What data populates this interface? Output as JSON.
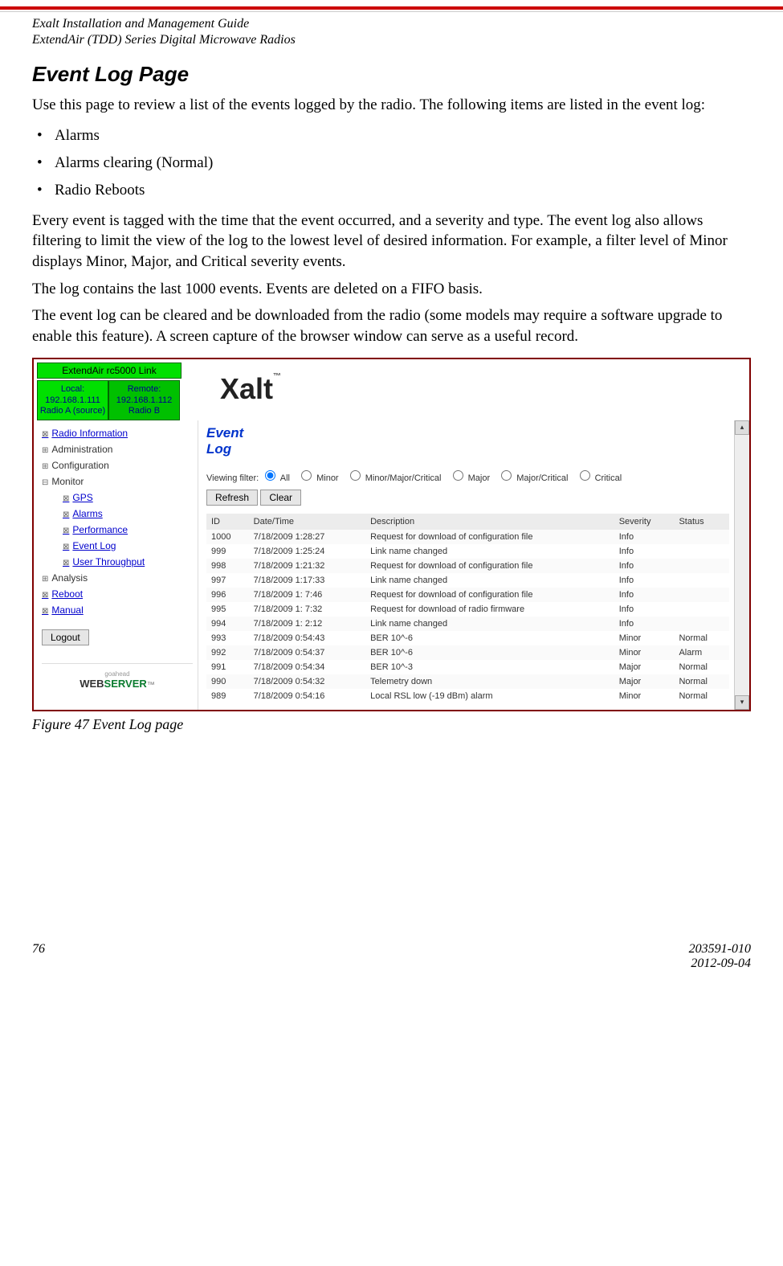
{
  "header": {
    "line1": "Exalt Installation and Management Guide",
    "line2": "ExtendAir (TDD) Series Digital Microwave Radios"
  },
  "title": "Event Log Page",
  "intro": "Use this page to review a list of the events logged by the radio. The following items are listed in the event log:",
  "bullets": [
    "Alarms",
    "Alarms clearing (Normal)",
    "Radio Reboots"
  ],
  "para1": "Every event is tagged with the time that the event occurred, and a severity and type. The event log also allows filtering to limit the view of the log to the lowest level of desired information. For example, a filter level of Minor displays Minor, Major, and Critical severity events.",
  "para2": "The log contains the last 1000 events. Events are deleted on a FIFO basis.",
  "para3": "The event log can be cleared and be downloaded from the radio (some models may require a software upgrade to enable this feature). A screen capture of the browser window can serve as a useful record.",
  "screenshot": {
    "link_name": "ExtendAir rc5000 Link",
    "local": {
      "l1": "Local:",
      "l2": "192.168.1.111",
      "l3": "Radio A (source)"
    },
    "remote": {
      "l1": "Remote:",
      "l2": "192.168.1.112",
      "l3": "Radio B"
    },
    "brand": "Xalt",
    "nav": {
      "radio_info": "Radio Information",
      "admin": "Administration",
      "config": "Configuration",
      "monitor": "Monitor",
      "gps": "GPS",
      "alarms": "Alarms",
      "perf": "Performance",
      "eventlog": "Event Log",
      "userthru": "User Throughput",
      "analysis": "Analysis",
      "reboot": "Reboot",
      "manual": "Manual",
      "logout": "Logout"
    },
    "webserver": {
      "go": "goahead",
      "web": "WEB",
      "server": "SERVER"
    },
    "main_title_l1": "Event",
    "main_title_l2": "Log",
    "filter_label": "Viewing filter:",
    "filters": [
      "All",
      "Minor",
      "Minor/Major/Critical",
      "Major",
      "Major/Critical",
      "Critical"
    ],
    "refresh": "Refresh",
    "clear": "Clear",
    "cols": {
      "id": "ID",
      "dt": "Date/Time",
      "desc": "Description",
      "sev": "Severity",
      "status": "Status"
    },
    "rows": [
      {
        "id": "1000",
        "dt": "7/18/2009 1:28:27",
        "desc": "Request for download of configuration file",
        "sev": "Info",
        "status": ""
      },
      {
        "id": "999",
        "dt": "7/18/2009 1:25:24",
        "desc": "Link name changed",
        "sev": "Info",
        "status": ""
      },
      {
        "id": "998",
        "dt": "7/18/2009 1:21:32",
        "desc": "Request for download of configuration file",
        "sev": "Info",
        "status": ""
      },
      {
        "id": "997",
        "dt": "7/18/2009 1:17:33",
        "desc": "Link name changed",
        "sev": "Info",
        "status": ""
      },
      {
        "id": "996",
        "dt": "7/18/2009 1: 7:46",
        "desc": "Request for download of configuration file",
        "sev": "Info",
        "status": ""
      },
      {
        "id": "995",
        "dt": "7/18/2009 1: 7:32",
        "desc": "Request for download of radio firmware",
        "sev": "Info",
        "status": ""
      },
      {
        "id": "994",
        "dt": "7/18/2009 1: 2:12",
        "desc": "Link name changed",
        "sev": "Info",
        "status": ""
      },
      {
        "id": "993",
        "dt": "7/18/2009 0:54:43",
        "desc": "BER 10^-6",
        "sev": "Minor",
        "status": "Normal"
      },
      {
        "id": "992",
        "dt": "7/18/2009 0:54:37",
        "desc": "BER 10^-6",
        "sev": "Minor",
        "status": "Alarm"
      },
      {
        "id": "991",
        "dt": "7/18/2009 0:54:34",
        "desc": "BER 10^-3",
        "sev": "Major",
        "status": "Normal"
      },
      {
        "id": "990",
        "dt": "7/18/2009 0:54:32",
        "desc": "Telemetry down",
        "sev": "Major",
        "status": "Normal"
      },
      {
        "id": "989",
        "dt": "7/18/2009 0:54:16",
        "desc": "Local RSL low (-19 dBm) alarm",
        "sev": "Minor",
        "status": "Normal"
      }
    ]
  },
  "figcaption": "Figure 47   Event Log page",
  "footer": {
    "page": "76",
    "doc": "203591-010",
    "date": "2012-09-04"
  }
}
